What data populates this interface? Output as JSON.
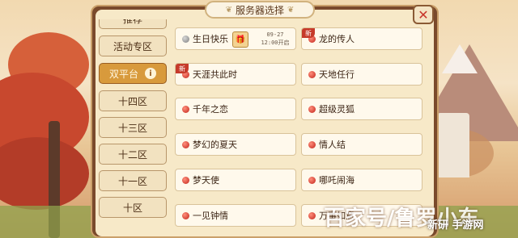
{
  "dialog": {
    "title": "服务器选择",
    "close_glyph": "✕"
  },
  "sidebar": {
    "items": [
      {
        "label": "推荐",
        "active": false
      },
      {
        "label": "活动专区",
        "active": false
      },
      {
        "label": "双平台",
        "active": true,
        "info": "i"
      },
      {
        "label": "十四区",
        "active": false
      },
      {
        "label": "十三区",
        "active": false
      },
      {
        "label": "十二区",
        "active": false
      },
      {
        "label": "十一区",
        "active": false
      },
      {
        "label": "十区",
        "active": false
      }
    ]
  },
  "servers": [
    {
      "name": "生日快乐",
      "status": "grey",
      "date": "09-27",
      "time": "12:00开启"
    },
    {
      "name": "龙的传人",
      "status": "red",
      "tag": "新"
    },
    {
      "name": "天涯共此时",
      "status": "red",
      "tag": "新"
    },
    {
      "name": "天地任行",
      "status": "red"
    },
    {
      "name": "千年之恋",
      "status": "red"
    },
    {
      "name": "超级灵狐",
      "status": "red"
    },
    {
      "name": "梦幻的夏天",
      "status": "red"
    },
    {
      "name": "情人结",
      "status": "red"
    },
    {
      "name": "梦天使",
      "status": "red"
    },
    {
      "name": "哪吒闹海",
      "status": "red"
    },
    {
      "name": "一见钟情",
      "status": "red"
    },
    {
      "name": "万事如意",
      "status": "red"
    }
  ],
  "watermark": {
    "text": "百家号/鲁罗小东",
    "site": "新研 手游网"
  },
  "colors": {
    "accent": "#d89a3c",
    "status_red": "#c2231a",
    "status_grey": "#7e7e7e"
  }
}
